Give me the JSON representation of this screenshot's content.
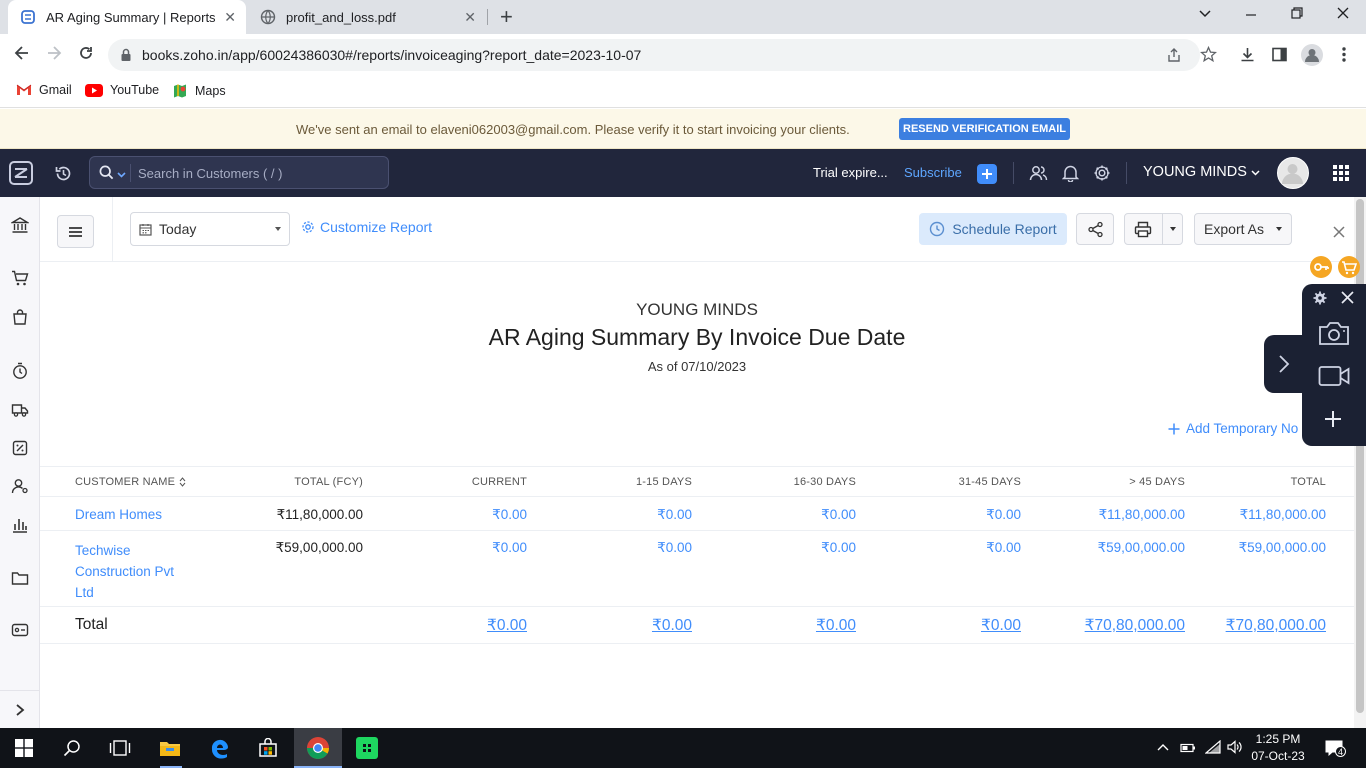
{
  "browser": {
    "tabs": [
      {
        "title": "AR Aging Summary | Reports | Z",
        "active": true
      },
      {
        "title": "profit_and_loss.pdf",
        "active": false
      }
    ],
    "url": "books.zoho.in/app/60024386030#/reports/invoiceaging?report_date=2023-10-07",
    "bookmarks": [
      "Gmail",
      "YouTube",
      "Maps"
    ]
  },
  "banner": {
    "message": "We've sent an email to elaveni062003@gmail.com. Please verify it to start invoicing your clients.",
    "button": "RESEND VERIFICATION EMAIL"
  },
  "header": {
    "search_placeholder": "Search in Customers ( / )",
    "trial": "Trial expire...",
    "subscribe": "Subscribe",
    "org": "YOUNG MINDS"
  },
  "toolbar": {
    "date_filter": "Today",
    "customize": "Customize Report",
    "schedule": "Schedule Report",
    "export": "Export As"
  },
  "report": {
    "org": "YOUNG MINDS",
    "title": "AR Aging Summary By Invoice Due Date",
    "as_of": "As of 07/10/2023",
    "add_note": "Add Temporary No",
    "columns": [
      "CUSTOMER NAME",
      "TOTAL (FCY)",
      "CURRENT",
      "1-15 DAYS",
      "16-30 DAYS",
      "31-45 DAYS",
      "> 45 DAYS",
      "TOTAL"
    ],
    "rows": [
      {
        "customer": "Dream Homes",
        "fcy": "₹11,80,000.00",
        "current": "₹0.00",
        "d1_15": "₹0.00",
        "d16_30": "₹0.00",
        "d31_45": "₹0.00",
        "d45": "₹11,80,000.00",
        "total": "₹11,80,000.00"
      },
      {
        "customer_lines": [
          "Techwise",
          "Construction Pvt",
          "Ltd"
        ],
        "fcy": "₹59,00,000.00",
        "current": "₹0.00",
        "d1_15": "₹0.00",
        "d16_30": "₹0.00",
        "d31_45": "₹0.00",
        "d45": "₹59,00,000.00",
        "total": "₹59,00,000.00"
      }
    ],
    "total_row": {
      "label": "Total",
      "current": "₹0.00",
      "d1_15": "₹0.00",
      "d16_30": "₹0.00",
      "d31_45": "₹0.00",
      "d45": "₹70,80,000.00",
      "total": "₹70,80,000.00"
    }
  },
  "taskbar": {
    "time": "1:25 PM",
    "date": "07-Oct-23",
    "notifications": "4"
  },
  "colors": {
    "accent": "#408dfb",
    "header": "#21263c",
    "banner": "#fcf8e8",
    "resend": "#3c7fe0"
  }
}
